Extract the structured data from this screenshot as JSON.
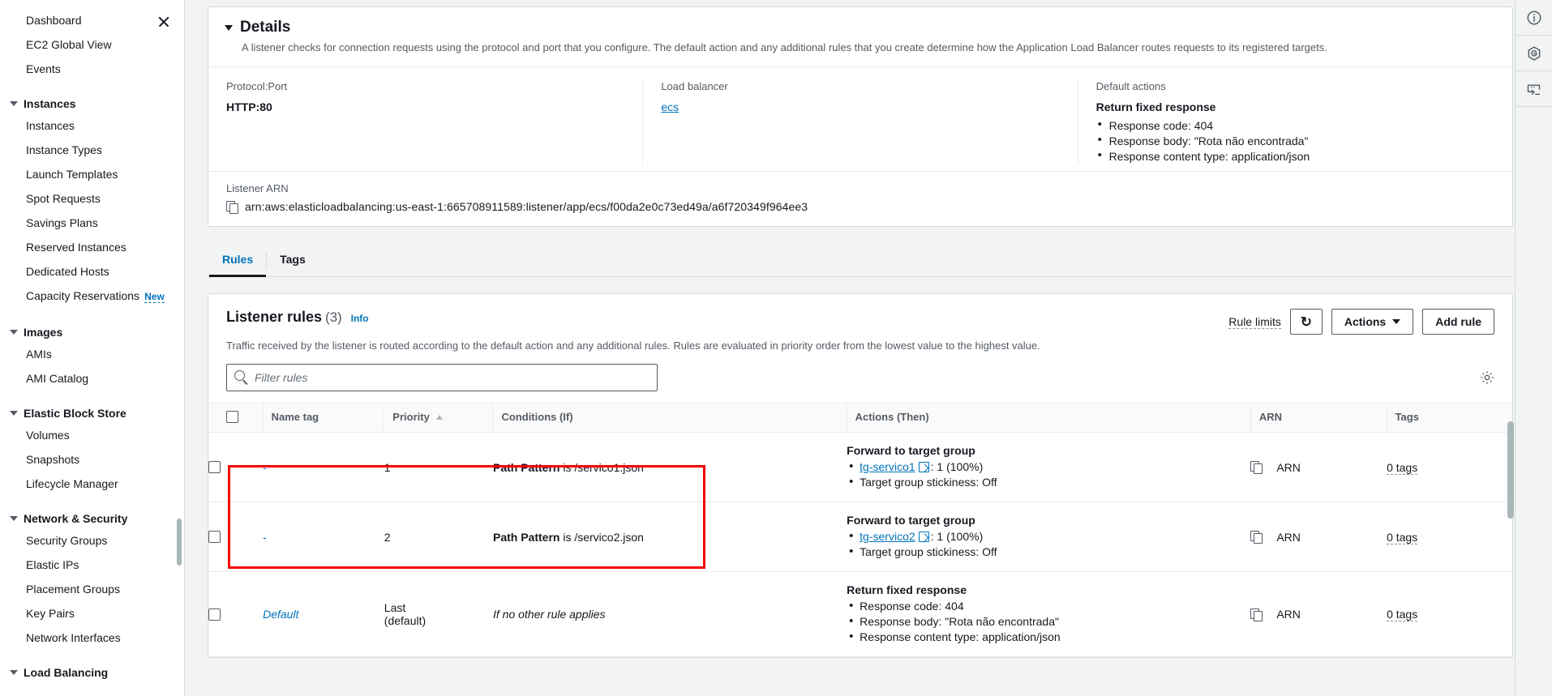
{
  "sidebar": {
    "top_items": [
      {
        "label": "Dashboard"
      },
      {
        "label": "EC2 Global View"
      },
      {
        "label": "Events"
      }
    ],
    "close_icon": "close-icon",
    "groups": [
      {
        "label": "Instances",
        "items": [
          {
            "label": "Instances"
          },
          {
            "label": "Instance Types"
          },
          {
            "label": "Launch Templates"
          },
          {
            "label": "Spot Requests"
          },
          {
            "label": "Savings Plans"
          },
          {
            "label": "Reserved Instances"
          },
          {
            "label": "Dedicated Hosts"
          },
          {
            "label": "Capacity Reservations",
            "badge": "New"
          }
        ]
      },
      {
        "label": "Images",
        "items": [
          {
            "label": "AMIs"
          },
          {
            "label": "AMI Catalog"
          }
        ]
      },
      {
        "label": "Elastic Block Store",
        "items": [
          {
            "label": "Volumes"
          },
          {
            "label": "Snapshots"
          },
          {
            "label": "Lifecycle Manager"
          }
        ]
      },
      {
        "label": "Network & Security",
        "items": [
          {
            "label": "Security Groups"
          },
          {
            "label": "Elastic IPs"
          },
          {
            "label": "Placement Groups"
          },
          {
            "label": "Key Pairs"
          },
          {
            "label": "Network Interfaces"
          }
        ]
      },
      {
        "label": "Load Balancing",
        "items": []
      }
    ]
  },
  "details": {
    "title": "Details",
    "description": "A listener checks for connection requests using the protocol and port that you configure. The default action and any additional rules that you create determine how the Application Load Balancer routes requests to its registered targets.",
    "protocol_port": {
      "label": "Protocol:Port",
      "value": "HTTP:80"
    },
    "load_balancer": {
      "label": "Load balancer",
      "value": "ecs"
    },
    "default_actions": {
      "label": "Default actions",
      "heading": "Return fixed response",
      "items": [
        "Response code: 404",
        "Response body: \"Rota não encontrada\"",
        "Response content type: application/json"
      ]
    },
    "listener_arn": {
      "label": "Listener ARN",
      "value": "arn:aws:elasticloadbalancing:us-east-1:665708911589:listener/app/ecs/f00da2e0c73ed49a/a6f720349f964ee3",
      "copy_icon": "copy-icon"
    }
  },
  "tabs": [
    {
      "label": "Rules",
      "active": true
    },
    {
      "label": "Tags",
      "active": false
    }
  ],
  "rules_panel": {
    "title": "Listener rules",
    "count": "(3)",
    "info": "Info",
    "subtitle": "Traffic received by the listener is routed according to the default action and any additional rules. Rules are evaluated in priority order from the lowest value to the highest value.",
    "rule_limits": "Rule limits",
    "refresh_icon": "refresh-icon",
    "actions_button": "Actions",
    "add_rule_button": "Add rule",
    "settings_icon": "gear-icon",
    "search_placeholder": "Filter rules",
    "search_value": "",
    "columns": [
      "Name tag",
      "Priority",
      "Conditions (If)",
      "Actions (Then)",
      "ARN",
      "Tags"
    ],
    "rows": [
      {
        "name_tag": "-",
        "priority": "1",
        "condition_label": "Path Pattern",
        "condition_rest": " is /servico1.json",
        "action_heading": "Forward to target group",
        "action_link": "tg-servico1",
        "action_link_suffix": ": 1 (100%)",
        "action_second": "Target group stickiness: Off",
        "arn": "ARN",
        "tags": "0 tags"
      },
      {
        "name_tag": "-",
        "priority": "2",
        "condition_label": "Path Pattern",
        "condition_rest": " is /servico2.json",
        "action_heading": "Forward to target group",
        "action_link": "tg-servico2",
        "action_link_suffix": ": 1 (100%)",
        "action_second": "Target group stickiness: Off",
        "arn": "ARN",
        "tags": "0 tags"
      }
    ],
    "default_row": {
      "name_tag": "Default",
      "priority_line1": "Last",
      "priority_line2": "(default)",
      "condition": "If no other rule applies",
      "action_heading": "Return fixed response",
      "actions": [
        "Response code: 404",
        "Response body: \"Rota não encontrada\"",
        "Response content type: application/json"
      ],
      "arn": "ARN",
      "tags": "0 tags"
    }
  },
  "right_rail": [
    {
      "icon": "info-circle-icon"
    },
    {
      "icon": "shield-icon"
    },
    {
      "icon": "cloudshell-icon"
    }
  ],
  "colors": {
    "accent_link": "#0073bb",
    "highlight_box": "#f60000",
    "text": "#16191f",
    "muted": "#545b64",
    "panel_bg": "#ffffff",
    "page_bg": "#f2f3f3"
  }
}
